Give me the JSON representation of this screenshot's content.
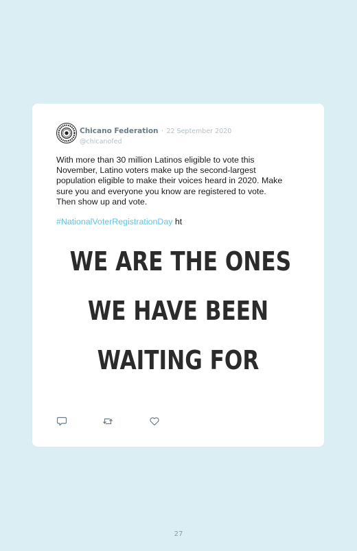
{
  "tweet": {
    "author_name": "Chicano Federation",
    "separator": "·",
    "date": "22 September 2020",
    "handle": "@chicanofed",
    "body_lines": [
      "With more than 30 million Latinos eligible to vote this",
      "November, Latino voters make up the second-largest",
      "population eligible to make their voices heard in 2020. Make",
      "sure you and everyone you know are registered to vote.",
      "Then show up and vote."
    ],
    "hashtag": "#NationalVoterRegistrationDay",
    "hashtag_trailing": " ht",
    "image_text": {
      "line1": "WE ARE THE ONES",
      "line2": "WE HAVE BEEN",
      "line3": "WAITING FOR"
    },
    "actions": {
      "reply_icon": "reply-icon",
      "retweet_icon": "retweet-icon",
      "like_icon": "heart-icon"
    }
  },
  "page": {
    "number": "27"
  },
  "colors": {
    "background": "#daeef4",
    "card": "#ffffff",
    "hashtag": "#5ec4e4",
    "author": "#6a7b85",
    "muted": "#b3c0c7",
    "poster_text": "#2b2b2b"
  }
}
